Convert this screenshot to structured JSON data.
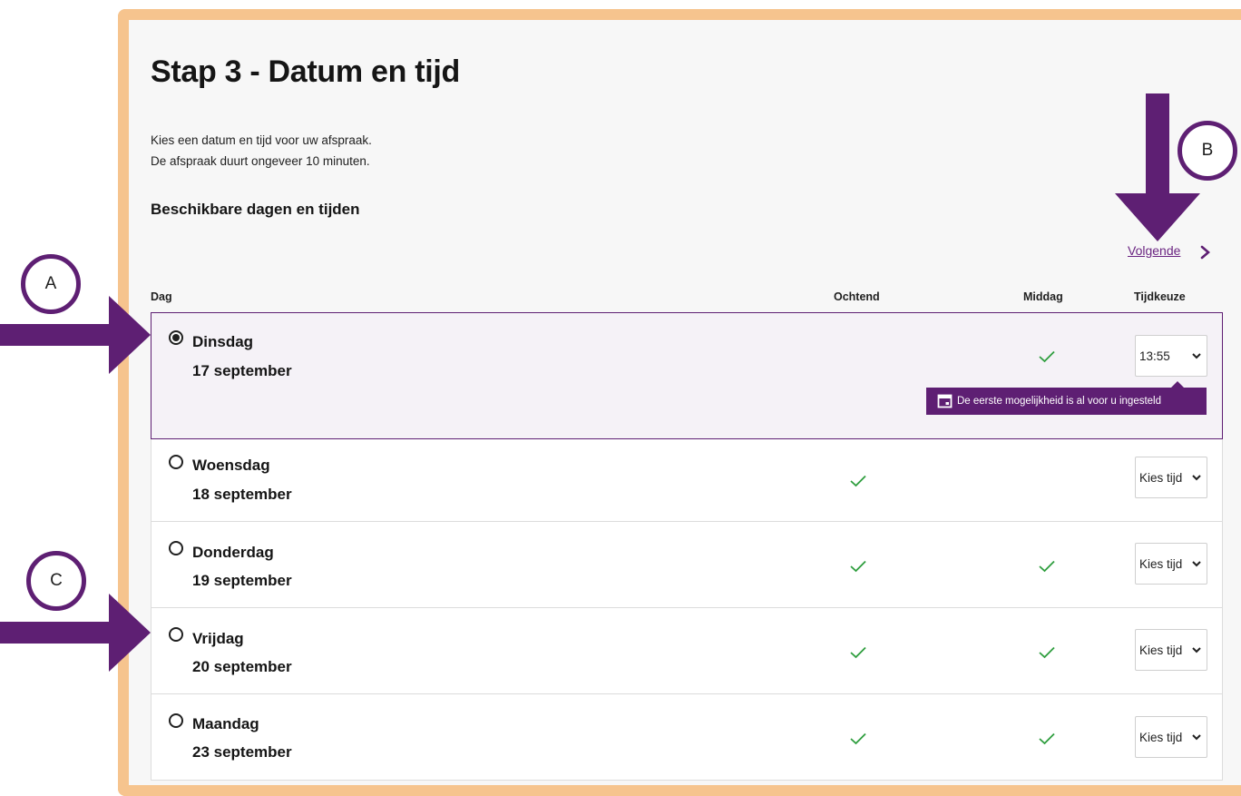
{
  "page": {
    "title": "Stap 3 - Datum en tijd",
    "intro_line1": "Kies een datum en tijd voor uw afspraak.",
    "intro_line2": "De afspraak duurt ongeveer 10 minuten.",
    "subheading": "Beschikbare dagen en tijden",
    "next_label": "Volgende"
  },
  "table": {
    "headers": {
      "day": "Dag",
      "morning": "Ochtend",
      "afternoon": "Middag",
      "time": "Tijdkeuze"
    },
    "rows": [
      {
        "day": "Dinsdag",
        "date": "17 september",
        "morning": false,
        "afternoon": true,
        "selected": true,
        "time": "13:55"
      },
      {
        "day": "Woensdag",
        "date": "18 september",
        "morning": true,
        "afternoon": false,
        "selected": false,
        "time": "Kies tijd"
      },
      {
        "day": "Donderdag",
        "date": "19 september",
        "morning": true,
        "afternoon": true,
        "selected": false,
        "time": "Kies tijd"
      },
      {
        "day": "Vrijdag",
        "date": "20 september",
        "morning": true,
        "afternoon": true,
        "selected": false,
        "time": "Kies tijd"
      },
      {
        "day": "Maandag",
        "date": "23 september",
        "morning": true,
        "afternoon": true,
        "selected": false,
        "time": "Kies tijd"
      }
    ]
  },
  "tooltip": {
    "text": "De eerste mogelijkheid is al voor u ingesteld",
    "icon": "calendar-icon"
  },
  "annotations": {
    "a": "A",
    "b": "B",
    "c": "C"
  },
  "colors": {
    "accent": "#5e1f73",
    "frame": "#f6c48e",
    "check": "#2e9e3e"
  }
}
